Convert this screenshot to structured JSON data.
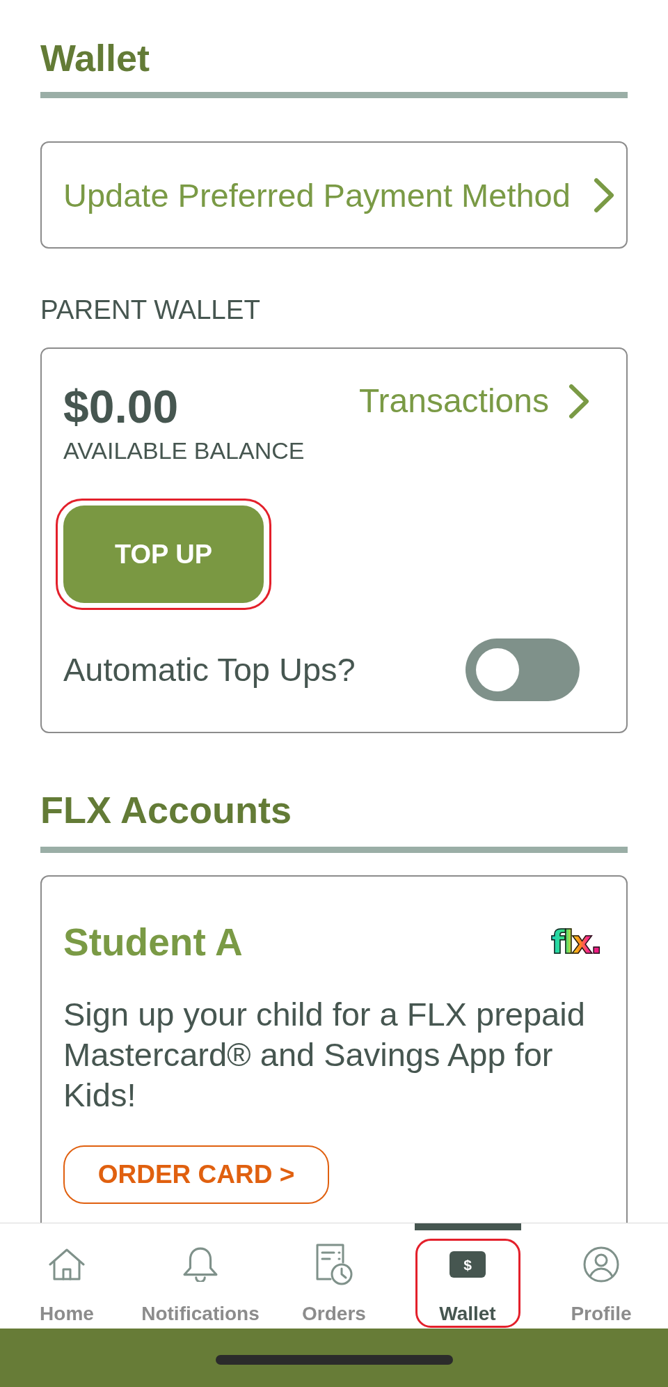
{
  "header": {
    "title": "Wallet"
  },
  "payment_method_button": {
    "label": "Update Preferred Payment Method"
  },
  "parent_wallet": {
    "section_label": "PARENT WALLET",
    "balance": "$0.00",
    "balance_caption": "AVAILABLE BALANCE",
    "transactions_link": "Transactions",
    "top_up": {
      "label": "TOP UP",
      "highlighted": true
    },
    "automatic_top_ups": {
      "label": "Automatic Top Ups?",
      "on": false
    }
  },
  "flx_accounts": {
    "title": "FLX Accounts",
    "accounts": [
      {
        "name": "Student A",
        "logo": "flx.",
        "description": "Sign up your child for a FLX prepaid Mastercard® and Savings App for Kids!",
        "button": "ORDER CARD >"
      }
    ]
  },
  "nav": [
    {
      "kind": "home",
      "label": "Home",
      "selected": false,
      "highlighted": false
    },
    {
      "kind": "bell",
      "label": "Notifications",
      "selected": false,
      "highlighted": false
    },
    {
      "kind": "orders",
      "label": "Orders",
      "selected": false,
      "highlighted": false
    },
    {
      "kind": "wallet",
      "label": "Wallet",
      "icon_text": "$",
      "selected": true,
      "highlighted": true
    },
    {
      "kind": "profile",
      "label": "Profile",
      "selected": false,
      "highlighted": false
    }
  ]
}
